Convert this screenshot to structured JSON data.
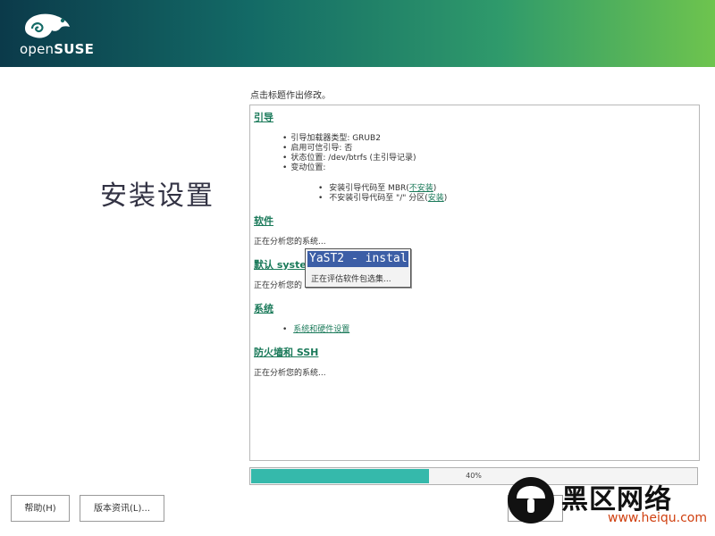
{
  "header": {
    "logo_text_light": "open",
    "logo_text_bold": "SUSE"
  },
  "page_title": "安装设置",
  "hint": "点击标题作出修改。",
  "sections": {
    "boot": {
      "title": "引导",
      "items": [
        "引导加载器类型: GRUB2",
        "启用可信引导: 否",
        "状态位置: /dev/btrfs (主引导记录)",
        "变动位置:"
      ],
      "sub_items": [
        {
          "text": "安装引导代码至 MBR(",
          "link": "不安装",
          "tail": ")"
        },
        {
          "text": "不安装引导代码至 \"/\" 分区(",
          "link": "安装",
          "tail": ")"
        }
      ]
    },
    "software": {
      "title": "软件",
      "status": "正在分析您的系统..."
    },
    "default_target": {
      "title": "默认 syste",
      "status": "正在分析您的"
    },
    "system": {
      "title": "系统",
      "link": "系统和硬件设置"
    },
    "firewall": {
      "title": "防火墙和 SSH",
      "status": "正在分析您的系统..."
    }
  },
  "popup": {
    "title": "YaST2 - instal",
    "message": "正在评估软件包选集..."
  },
  "progress": {
    "value": 0.4,
    "label": "40%"
  },
  "buttons": {
    "help": "帮助(H)",
    "release_notes": "版本资讯(L)..."
  },
  "watermark": {
    "main": "黑区网络",
    "url": "www.heiqu.com"
  },
  "colors": {
    "accent": "#1b7a5a",
    "progress": "#35b9ab",
    "popup_title": "#3c5ea6"
  }
}
